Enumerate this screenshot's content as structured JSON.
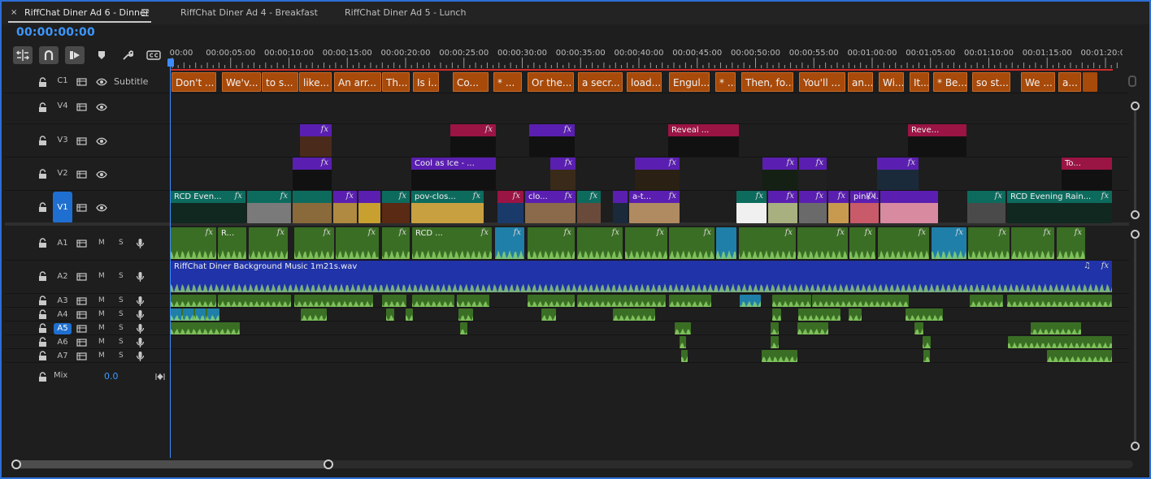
{
  "tabs": [
    {
      "label": "RiffChat Diner Ad 6 - Dinner",
      "active": true
    },
    {
      "label": "RiffChat Diner Ad 4 - Breakfast",
      "active": false
    },
    {
      "label": "RiffChat Diner Ad 5 - Lunch",
      "active": false
    }
  ],
  "tab_close_glyph": "×",
  "tab_menu_glyph": "☰",
  "timecode": "00:00:00:00",
  "toolbar": [
    {
      "name": "snap-insert-icon"
    },
    {
      "name": "magnet-icon"
    },
    {
      "name": "linked-selection-icon"
    },
    {
      "name": "marker-icon"
    },
    {
      "name": "wrench-icon"
    },
    {
      "name": "captions-icon"
    }
  ],
  "ruler_ticks": [
    "00:00",
    "00:00:05:00",
    "00:00:10:00",
    "00:00:15:00",
    "00:00:20:00",
    "00:00:25:00",
    "00:00:30:00",
    "00:00:35:00",
    "00:00:40:00",
    "00:00:45:00",
    "00:00:50:00",
    "00:00:55:00",
    "00:01:00:00",
    "00:01:05:00",
    "00:01:10:00",
    "00:01:15:00",
    "00:01:20:00"
  ],
  "tracks": {
    "subtitle": {
      "label": "C1",
      "name": "Subtitle"
    },
    "video": [
      {
        "label": "V4"
      },
      {
        "label": "V3"
      },
      {
        "label": "V2"
      },
      {
        "label": "V1",
        "targeted": true
      }
    ],
    "audio": [
      {
        "label": "A1",
        "m": "M",
        "s": "S"
      },
      {
        "label": "A2",
        "m": "M",
        "s": "S"
      },
      {
        "label": "A3",
        "m": "M",
        "s": "S"
      },
      {
        "label": "A4",
        "m": "M",
        "s": "S"
      },
      {
        "label": "A5",
        "m": "M",
        "s": "S",
        "targeted": true
      },
      {
        "label": "A6",
        "m": "M",
        "s": "S"
      },
      {
        "label": "A7",
        "m": "M",
        "s": "S"
      }
    ],
    "mix": {
      "label": "Mix",
      "value": "0.0"
    }
  },
  "subtitle_clips": [
    "Don't ...",
    "We'v...",
    "to s...",
    "like...",
    "An arr...",
    "Th...",
    "Is i...",
    "Co...",
    "* ...",
    "Or the...",
    "a secr...",
    "load...",
    "Engul...",
    "* ...",
    "Then, fo...",
    "You'll ...",
    "an...",
    "Wi...",
    "It...",
    "* Be...",
    "so st...",
    "We ...",
    "a..."
  ],
  "video_clip_labels": {
    "v3_reveal_a": "Reveal ...",
    "v3_reveal_b": "Reve...",
    "v2_cool": "Cool as Ice - ...",
    "v2_to": "To...",
    "v1_rcd_a": "RCD Even...",
    "v1_pov": "pov-clos...",
    "v1_clo": "clo...",
    "v1_at": "a-t...",
    "v1_pink": "pink-l...",
    "v1_rcd_b": "RCD Evening Rain..."
  },
  "audio_clip_labels": {
    "a1_r": "R...",
    "a1_rcd": "RCD ...",
    "a2_music": "RiffChat Diner Background Music 1m21s.wav"
  },
  "fx_label": "fx",
  "colors": {
    "accent": "#3d97ff",
    "subtitle_clip": "#a84a0a",
    "video_purple": "#5a1fb0",
    "video_magenta": "#9a1444",
    "video_teal": "#0d6b5e",
    "audio_green": "#3a6e24",
    "audio_music": "#2033a8",
    "audio_blue": "#1f7fa8",
    "ruler_red": "#d12a2a"
  }
}
